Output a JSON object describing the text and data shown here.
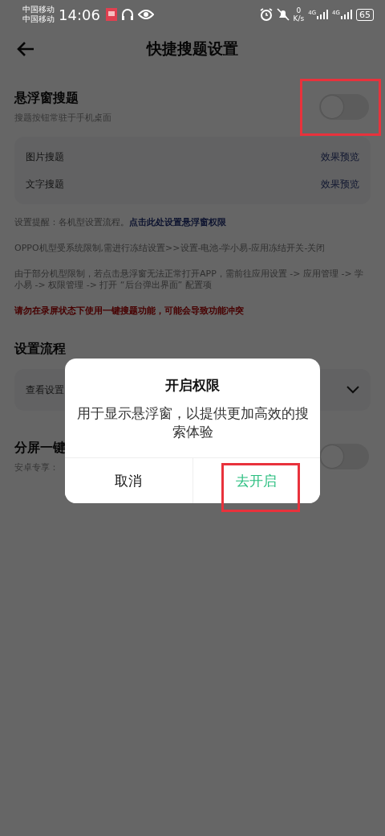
{
  "status_bar": {
    "carriers": [
      "中国移动",
      "中国移动"
    ],
    "time": "14:06",
    "speed_value": "0",
    "speed_unit": "K/s",
    "networks": [
      "4G",
      "4G"
    ],
    "battery": "65"
  },
  "header": {
    "title": "快捷搜题设置"
  },
  "floating_search": {
    "title": "悬浮窗搜题",
    "subtitle": "搜题按钮常驻于手机桌面",
    "on": false,
    "modes": [
      {
        "label": "图片搜题",
        "action": "效果预览"
      },
      {
        "label": "文字搜题",
        "action": "效果预览"
      }
    ]
  },
  "notes": [
    {
      "kind": "link",
      "text": "设置提醒：各机型设置流程。",
      "link": "点击此处设置悬浮窗权限"
    },
    {
      "kind": "plain",
      "text": "OPPO机型受系统限制,需进行冻结设置>>设置-电池-学小易-应用冻结开关-关闭"
    },
    {
      "kind": "plain",
      "text": "由于部分机型限制，若点击悬浮窗无法正常打开APP，需前往应用设置 -> 应用管理 -> 学小易 -> 权限管理 -> 打开 “后台弹出界面” 配置项"
    },
    {
      "kind": "warning",
      "text": "请勿在录屏状态下使用一键搜题功能，可能会导致功能冲突"
    }
  ],
  "setup": {
    "title": "设置流程",
    "dropdown": "查看设置",
    "expanded": false
  },
  "split_screen": {
    "title": "分屏一键",
    "subtitle": "安卓专享：",
    "on": false
  },
  "dialog": {
    "title": "开启权限",
    "message": "用于显示悬浮窗，以提供更加高效的搜索体验",
    "buttons": [
      {
        "label": "取消",
        "kind": "cancel"
      },
      {
        "label": "去开启",
        "kind": "confirm"
      }
    ]
  }
}
